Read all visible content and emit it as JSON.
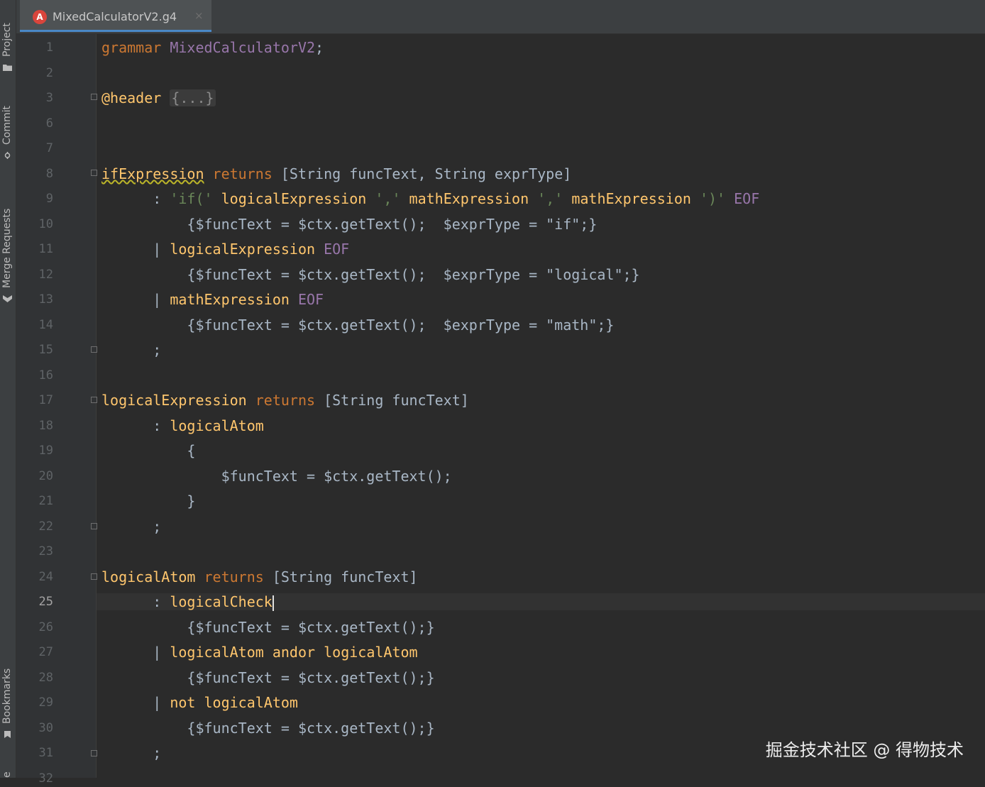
{
  "tool_window_bar": {
    "items": [
      {
        "label": "Project",
        "icon": "folder-icon"
      },
      {
        "label": "Commit",
        "icon": "commit-icon"
      },
      {
        "label": "Merge Requests",
        "icon": "merge-requests-icon"
      },
      {
        "label": "Bookmarks",
        "icon": "bookmark-icon"
      }
    ],
    "partial_bottom_label": "e"
  },
  "editor_tab": {
    "title": "MixedCalculatorV2.g4",
    "icon": "antlr-logo-icon",
    "logo_letter": "A",
    "close_glyph": "×"
  },
  "gutter": {
    "line_numbers": [
      "1",
      "2",
      "3",
      "6",
      "7",
      "8",
      "9",
      "10",
      "11",
      "12",
      "13",
      "14",
      "15",
      "16",
      "17",
      "18",
      "19",
      "20",
      "21",
      "22",
      "23",
      "24",
      "25",
      "26",
      "27",
      "28",
      "29",
      "30",
      "31",
      "32"
    ],
    "current_line": "25"
  },
  "code": {
    "line_1": {
      "kw": "grammar",
      "name": "MixedCalculatorV2",
      "punct": ";"
    },
    "line_3": {
      "at": "@header",
      "placeholder": "{...}"
    },
    "line_8": {
      "rule": "ifExpression",
      "kw": "returns",
      "args": "[String funcText, String exprType]"
    },
    "line_9": {
      "colon": ":",
      "lit1": "'if('",
      "ref1": "logicalExpression",
      "lit2": "','",
      "ref2": "mathExpression",
      "lit3": "','",
      "ref3": "mathExpression",
      "lit4": "')'",
      "eof": "EOF"
    },
    "line_10": {
      "action": "{$funcText = $ctx.getText();  $exprType = \"if\";}"
    },
    "line_11": {
      "bar": "|",
      "ref": "logicalExpression",
      "eof": "EOF"
    },
    "line_12": {
      "action": "{$funcText = $ctx.getText();  $exprType = \"logical\";}"
    },
    "line_13": {
      "bar": "|",
      "ref": "mathExpression",
      "eof": "EOF"
    },
    "line_14": {
      "action": "{$funcText = $ctx.getText();  $exprType = \"math\";}"
    },
    "line_15": {
      "semi": ";"
    },
    "line_17": {
      "rule": "logicalExpression",
      "kw": "returns",
      "args": "[String funcText]"
    },
    "line_18": {
      "colon": ":",
      "ref": "logicalAtom"
    },
    "line_19": {
      "brace": "{"
    },
    "line_20": {
      "action": "$funcText = $ctx.getText();"
    },
    "line_21": {
      "brace": "}"
    },
    "line_22": {
      "semi": ";"
    },
    "line_24": {
      "rule": "logicalAtom",
      "kw": "returns",
      "args": "[String funcText]"
    },
    "line_25": {
      "colon": ":",
      "ref": "logicalCheck"
    },
    "line_26": {
      "action": "{$funcText = $ctx.getText();}"
    },
    "line_27": {
      "bar": "|",
      "ref1": "logicalAtom",
      "ref2": "andor",
      "ref3": "logicalAtom"
    },
    "line_28": {
      "action": "{$funcText = $ctx.getText();}"
    },
    "line_29": {
      "bar": "|",
      "ref1": "not",
      "ref2": "logicalAtom"
    },
    "line_30": {
      "action": "{$funcText = $ctx.getText();}"
    },
    "line_31": {
      "semi": ";"
    }
  },
  "watermark": "掘金技术社区 @ 得物技术",
  "colors": {
    "editor_bg": "#2b2b2b",
    "keyword": "#cc7832",
    "rule_ref": "#ffc66d",
    "string": "#6a8759",
    "token": "#9876aa",
    "default_text": "#a9b7c6",
    "tab_underline": "#4a88c7"
  }
}
